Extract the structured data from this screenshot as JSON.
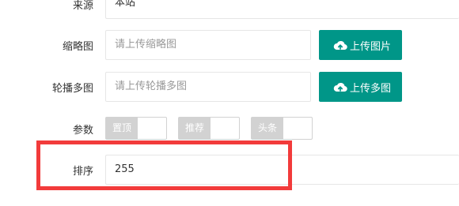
{
  "form": {
    "source": {
      "label": "来源",
      "value": "本站"
    },
    "thumbnail": {
      "label": "缩略图",
      "placeholder": "请上传缩略图",
      "button_label": "上传图片",
      "button_icon": "cloud-upload-icon"
    },
    "carousel": {
      "label": "轮播多图",
      "placeholder": "请上传轮播多图",
      "button_label": "上传多图",
      "button_icon": "cloud-upload-icon"
    },
    "params": {
      "label": "参数",
      "switches": [
        {
          "label": "置顶",
          "on": false
        },
        {
          "label": "推荐",
          "on": false
        },
        {
          "label": "头条",
          "on": false
        }
      ]
    },
    "sort": {
      "label": "排序",
      "value": "255"
    }
  },
  "colors": {
    "primary": "#009688",
    "highlight": "#f23b3b",
    "switch_off": "#d2d2d2"
  }
}
